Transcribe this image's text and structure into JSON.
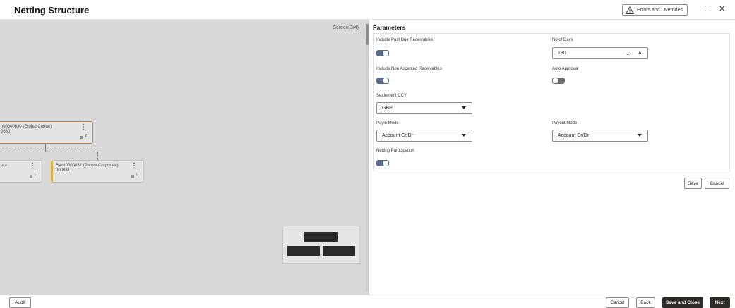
{
  "header": {
    "title": "Netting Structure",
    "errors_label": "Errors and Overrides",
    "collapse_icon": "⸬",
    "close_icon": "✕"
  },
  "canvas": {
    "screen_label": "Screen(3/4)",
    "nodes": [
      {
        "line1": "nk0000630 (Global Center)",
        "line2": "0630",
        "count": "2"
      },
      {
        "line1": "ora...",
        "line2": "",
        "count": "1"
      },
      {
        "line1": "Bank0000631 (Parent Corporate)",
        "line2": "000631",
        "count": "1"
      }
    ]
  },
  "parameters": {
    "title": "Parameters",
    "include_past_due_label": "Include Past Due Receivables",
    "include_past_due_on": true,
    "no_of_days_label": "No of Days",
    "no_of_days_value": "180",
    "include_non_accepted_label": "Include Non Accepted Receivables",
    "include_non_accepted_on": true,
    "auto_approval_label": "Auto Approval",
    "auto_approval_on": false,
    "settlement_ccy_label": "Settlement CCY",
    "settlement_ccy_value": "GBP",
    "payin_mode_label": "Payin Mode",
    "payin_mode_value": "Account Cr/Dr",
    "payout_mode_label": "Payout Mode",
    "payout_mode_value": "Account Cr/Dr",
    "netting_participation_label": "Netting Participation",
    "netting_participation_on": true,
    "save_label": "Save",
    "cancel_label": "Cancel"
  },
  "footer": {
    "audit_label": "Audit",
    "cancel_label": "Cancel",
    "back_label": "Back",
    "save_close_label": "Save and Close",
    "next_label": "Next"
  },
  "colors": {
    "toggle_on": "#5a6a8a",
    "toggle_off": "#6c6c6c",
    "primary_button": "#2d2b2a",
    "selected_node_border": "#c9824a",
    "parent_node_accent": "#d6b341"
  }
}
